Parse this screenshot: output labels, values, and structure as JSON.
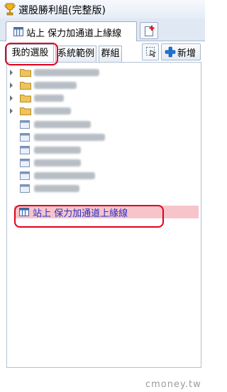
{
  "app": {
    "title": "選股勝利組(完整版)",
    "icon": "trophy-icon"
  },
  "doc_tab": {
    "label": "站上 保力加通道上緣線",
    "icon": "list-icon",
    "new_icon": "new-document-icon"
  },
  "tabs": [
    {
      "label": "我的選股",
      "active": true
    },
    {
      "label": "系統範例",
      "active": false
    },
    {
      "label": "群組",
      "active": false
    }
  ],
  "toolbar": {
    "select_icon": "pointer-icon",
    "add_label": "新增",
    "add_icon": "plus-icon"
  },
  "tree": {
    "folders": [
      {
        "icon": "folder-icon",
        "blurred": true
      },
      {
        "icon": "folder-icon",
        "blurred": true
      },
      {
        "icon": "folder-icon",
        "blurred": true
      },
      {
        "icon": "folder-icon",
        "blurred": true
      }
    ],
    "items": [
      {
        "icon": "list-icon",
        "blurred": true
      },
      {
        "icon": "list-icon",
        "blurred": true
      },
      {
        "icon": "list-icon",
        "blurred": true
      },
      {
        "icon": "list-icon",
        "blurred": true
      },
      {
        "icon": "list-icon",
        "blurred": true
      },
      {
        "icon": "list-icon",
        "blurred": true
      }
    ],
    "selected_item": {
      "label": "站上 保力加通道上緣線",
      "icon": "list-icon"
    }
  },
  "colors": {
    "highlight_ring": "#e1001a",
    "selected_bg": "#f7c4cb",
    "selected_text": "#2232c4",
    "folder": "#e8b84a"
  },
  "watermark": "cmoney.tw"
}
